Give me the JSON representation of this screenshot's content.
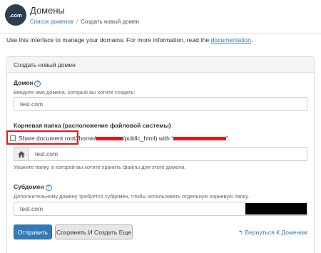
{
  "header": {
    "logo_text": ".com",
    "title": "Домены",
    "breadcrumb": {
      "parent": "Список доменов",
      "separator": "/",
      "current": "Создать новый домен"
    }
  },
  "intro": {
    "text": "Use this interface to manage your domains. For more information, read the ",
    "link": "documentation",
    "end": "."
  },
  "panel": {
    "heading": "Создать новый домен"
  },
  "domain": {
    "label": "Домен",
    "help": "?",
    "hint": "Введите имя домена, который вы хотите создать:",
    "value": "test.com"
  },
  "docroot": {
    "label": "Корневая папка (расположение файловой системы)",
    "share_label": "Share document root",
    "path_prefix": "(/home/",
    "path_mid": "/public_html) with “",
    "path_end": "”.",
    "home_icon": "home-icon",
    "value": "test.com",
    "hint": "Укажите папку, в которой вы хотите хранить файлы для этого домена."
  },
  "subdomain": {
    "label": "Субдомен",
    "help": "?",
    "hint": "Дополнительному домену требуется субдомен, чтобы использовать отдельную корневую папку.",
    "value": "test.com"
  },
  "actions": {
    "submit": "Отправить",
    "save_and_create": "Сохранить И Создать Еще",
    "back_arrow": "↰",
    "back": "Вернуться К Доменам"
  },
  "colors": {
    "primary": "#337ab7",
    "highlight": "#e8141b"
  }
}
